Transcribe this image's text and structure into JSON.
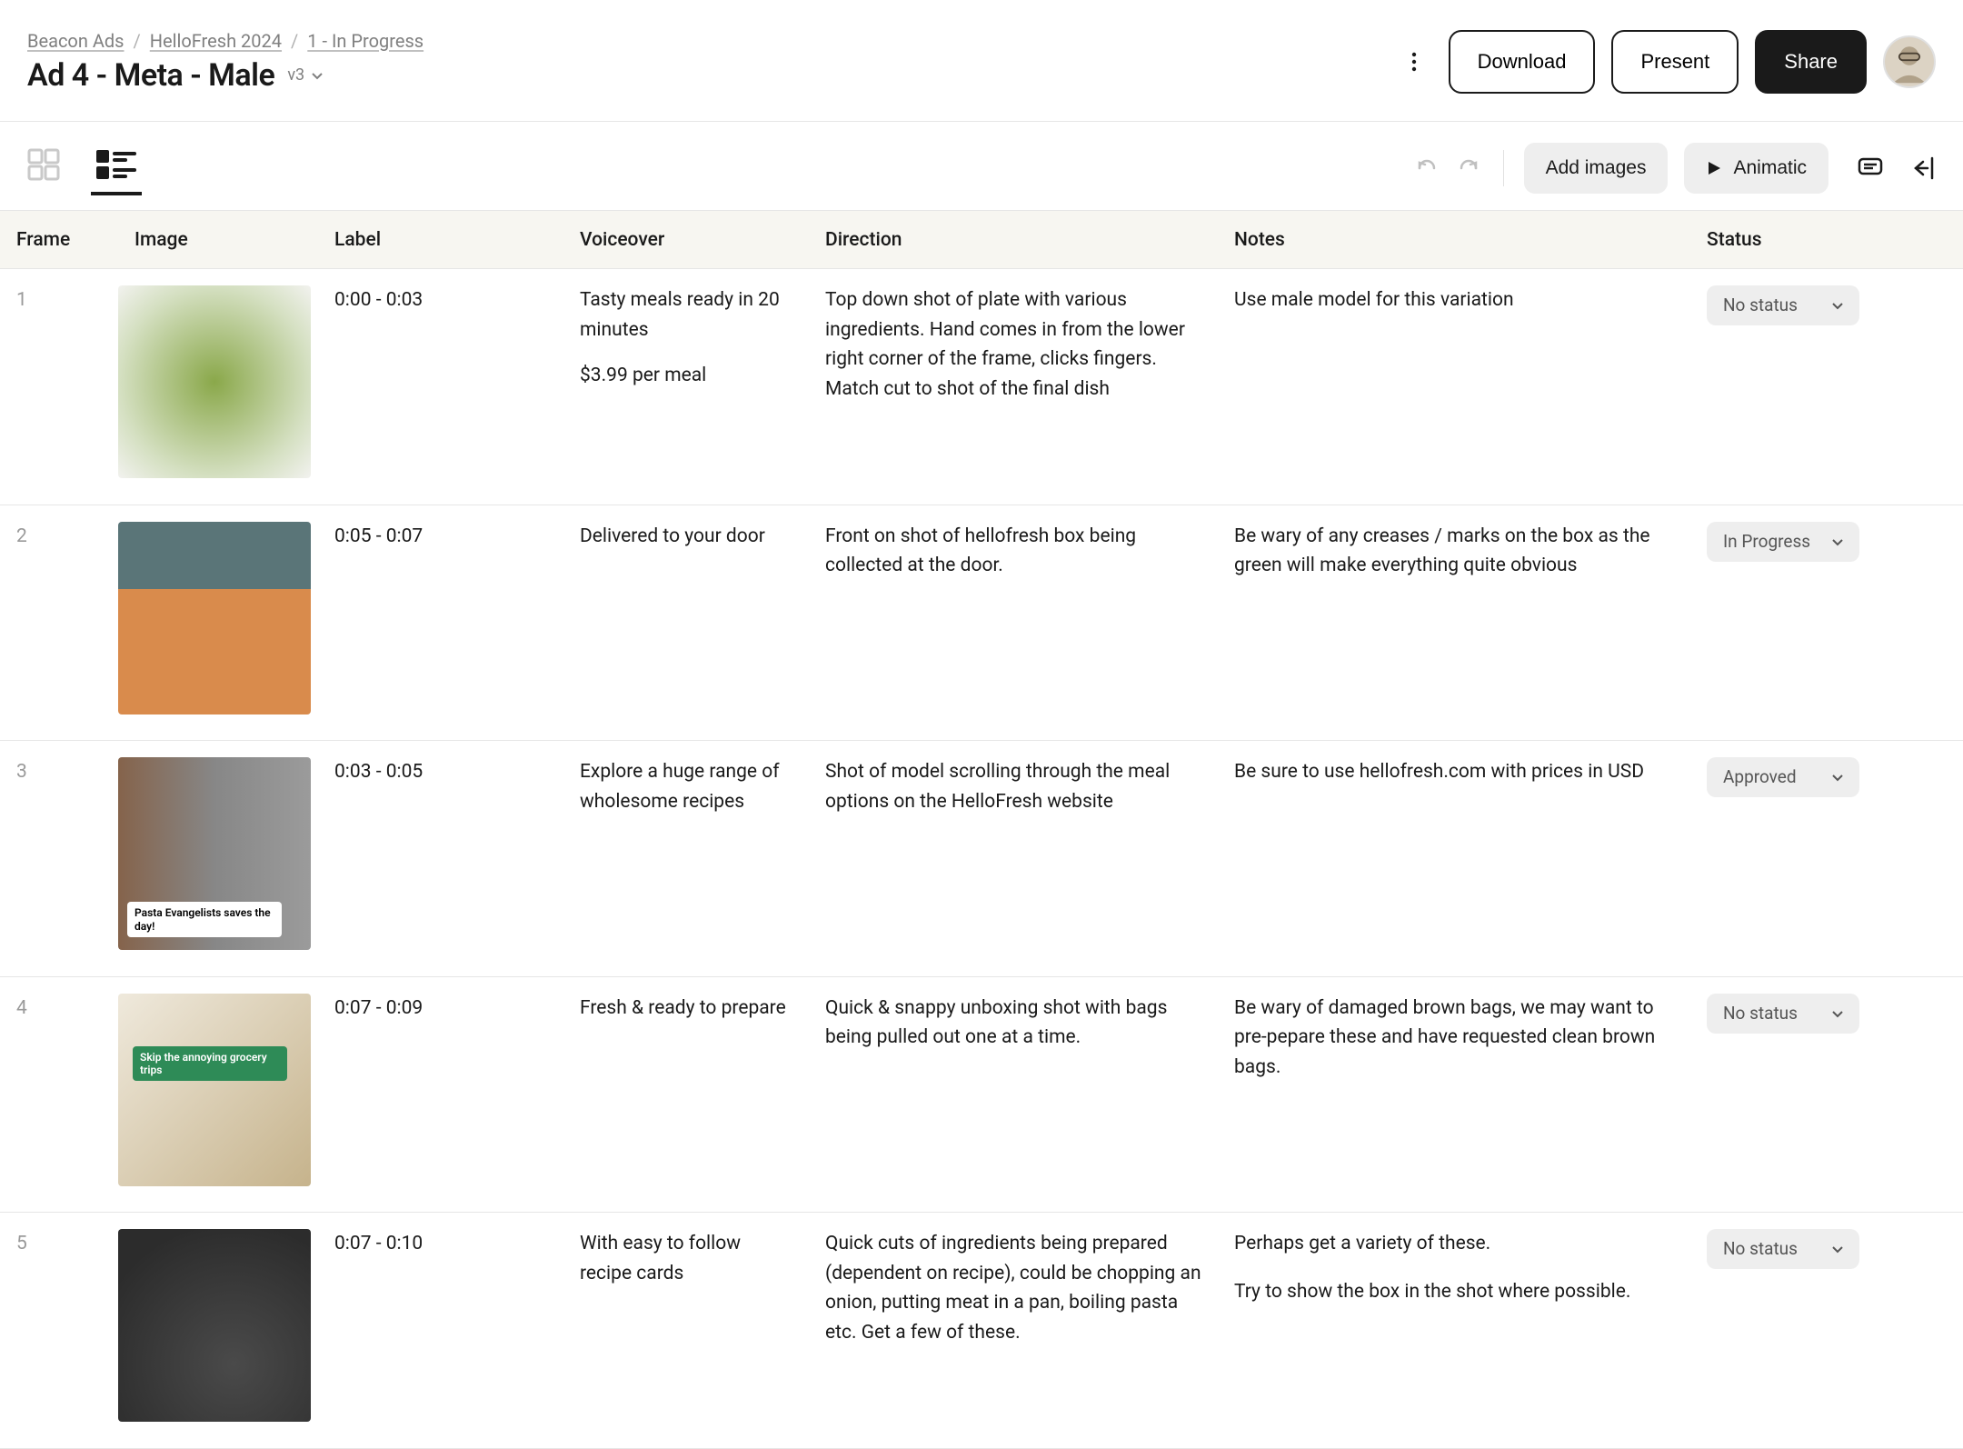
{
  "breadcrumb": {
    "items": [
      "Beacon Ads",
      "HelloFresh 2024",
      "1 - In Progress"
    ]
  },
  "page_title": "Ad 4 - Meta - Male",
  "version_label": "v3",
  "header_buttons": {
    "download": "Download",
    "present": "Present",
    "share": "Share"
  },
  "toolbar": {
    "add_images": "Add images",
    "animatic": "Animatic"
  },
  "columns": {
    "frame": "Frame",
    "image": "Image",
    "label": "Label",
    "voiceover": "Voiceover",
    "direction": "Direction",
    "notes": "Notes",
    "status": "Status"
  },
  "status_options": {
    "none": "No status",
    "in_progress": "In Progress",
    "approved": "Approved"
  },
  "rows": [
    {
      "num": "1",
      "label": "0:00 - 0:03",
      "voiceover": "Tasty meals ready in 20 minutes",
      "voiceover_extra": "$3.99 per meal",
      "direction": "Top down shot of plate with various ingredients. Hand comes in from the lower right corner of the frame, clicks fingers. Match cut to shot of the final dish",
      "notes": "Use male model for this variation",
      "notes_extra": "",
      "status": "No status",
      "thumb_class": "bg-salad",
      "thumb_caption": "",
      "thumb_caption_class": ""
    },
    {
      "num": "2",
      "label": "0:05 - 0:07",
      "voiceover": "Delivered to your door",
      "voiceover_extra": "",
      "direction": "Front on shot of hellofresh box being collected at the door.",
      "notes": "Be wary of any creases / marks on the box as the green will make everything quite obvious",
      "notes_extra": "",
      "status": "In Progress",
      "thumb_class": "bg-box",
      "thumb_caption": "",
      "thumb_caption_class": ""
    },
    {
      "num": "3",
      "label": "0:03 - 0:05",
      "voiceover": "Explore a huge range of wholesome recipes",
      "voiceover_extra": "",
      "direction": "Shot of model scrolling through the meal options on the HelloFresh website",
      "notes": "Be sure to use hellofresh.com with prices in USD",
      "notes_extra": "",
      "status": "Approved",
      "thumb_class": "bg-phone",
      "thumb_caption": "Pasta Evangelists saves the day!",
      "thumb_caption_class": ""
    },
    {
      "num": "4",
      "label": "0:07 - 0:09",
      "voiceover": "Fresh & ready to prepare",
      "voiceover_extra": "",
      "direction": "Quick & snappy unboxing shot with bags being pulled out one at a time.",
      "notes": "Be wary of damaged brown bags, we may want to pre-pepare these and have requested clean brown bags.",
      "notes_extra": "",
      "status": "No status",
      "thumb_class": "bg-bags",
      "thumb_caption": "Skip the annoying grocery trips",
      "thumb_caption_class": "green"
    },
    {
      "num": "5",
      "label": "0:07 - 0:10",
      "voiceover": "With easy to follow recipe cards",
      "voiceover_extra": "",
      "direction": "Quick cuts of ingredients being prepared (dependent on recipe), could be chopping an onion, putting meat in a pan, boiling pasta etc. Get a few of these.",
      "notes": "Perhaps get a variety of these.",
      "notes_extra": "Try to show the box in the shot where possible.",
      "status": "No status",
      "thumb_class": "bg-cook",
      "thumb_caption": "",
      "thumb_caption_class": ""
    }
  ]
}
